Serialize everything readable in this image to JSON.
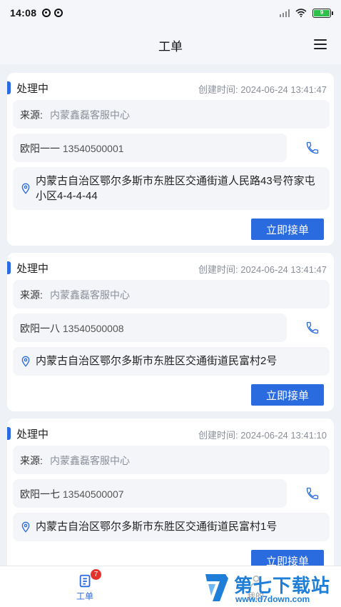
{
  "status_bar": {
    "time": "14:08",
    "battery": "9",
    "icons": [
      "app-notification-icon",
      "app-notification-icon",
      "signal-icon",
      "wifi-icon",
      "battery-icon"
    ]
  },
  "header": {
    "title": "工单",
    "menu_icon": "menu-icon"
  },
  "orders": [
    {
      "status": "处理中",
      "created_label": "创建时间:",
      "created_time": "2024-06-24 13:41:47",
      "source_label": "来源:",
      "source": "内蒙鑫磊客服中心",
      "contact_name": "欧阳一一",
      "phone": "13540500001",
      "address": "内蒙古自治区鄂尔多斯市东胜区交通街道人民路43号符家屯小区4-4-4-44",
      "accept_label": "立即接单"
    },
    {
      "status": "处理中",
      "created_label": "创建时间:",
      "created_time": "2024-06-24 13:41:47",
      "source_label": "来源:",
      "source": "内蒙鑫磊客服中心",
      "contact_name": "欧阳一八",
      "phone": "13540500008",
      "address": "内蒙古自治区鄂尔多斯市东胜区交通街道民富村2号",
      "accept_label": "立即接单"
    },
    {
      "status": "处理中",
      "created_label": "创建时间:",
      "created_time": "2024-06-24 13:41:10",
      "source_label": "来源:",
      "source": "内蒙鑫磊客服中心",
      "contact_name": "欧阳一七",
      "phone": "13540500007",
      "address": "内蒙古自治区鄂尔多斯市东胜区交通街道民富村1号",
      "accept_label": "立即接单"
    }
  ],
  "bottom_nav": {
    "orders_label": "工单",
    "orders_badge": "7",
    "mine_label": "我的"
  },
  "watermark": {
    "title": "第七下载站",
    "url": "www.d7down.com"
  },
  "colors": {
    "accent": "#2b6be0",
    "badge": "#e5322d",
    "background": "#eef1f5"
  }
}
